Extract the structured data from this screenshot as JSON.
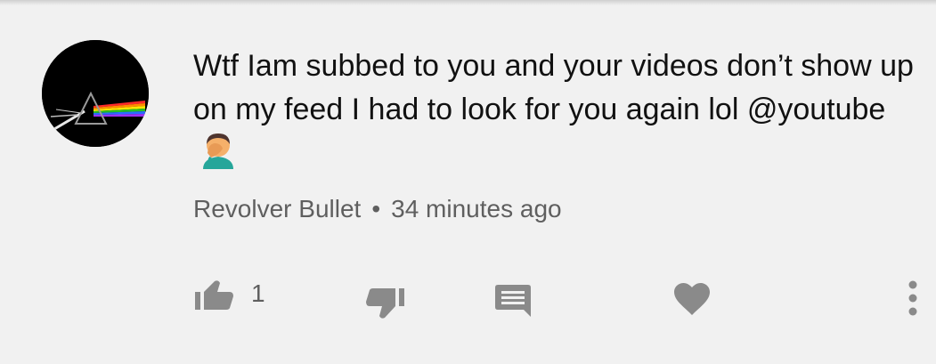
{
  "comment": {
    "text": "Wtf Iam subbed to you and your videos don’t show up on my feed I had to look for you again lol @youtube",
    "emoji": "man-facepalming",
    "author": "Revolver Bullet",
    "separator": "•",
    "time": "34 minutes ago",
    "like_count": "1"
  },
  "actions": {
    "icons": [
      "thumb-up-icon",
      "thumb-down-icon",
      "reply-icon",
      "heart-icon",
      "more-vert-icon"
    ]
  },
  "colors": {
    "background": "#f1f1f1",
    "text": "#111111",
    "meta": "#5f5f5f",
    "icon": "#8a8a8a"
  }
}
